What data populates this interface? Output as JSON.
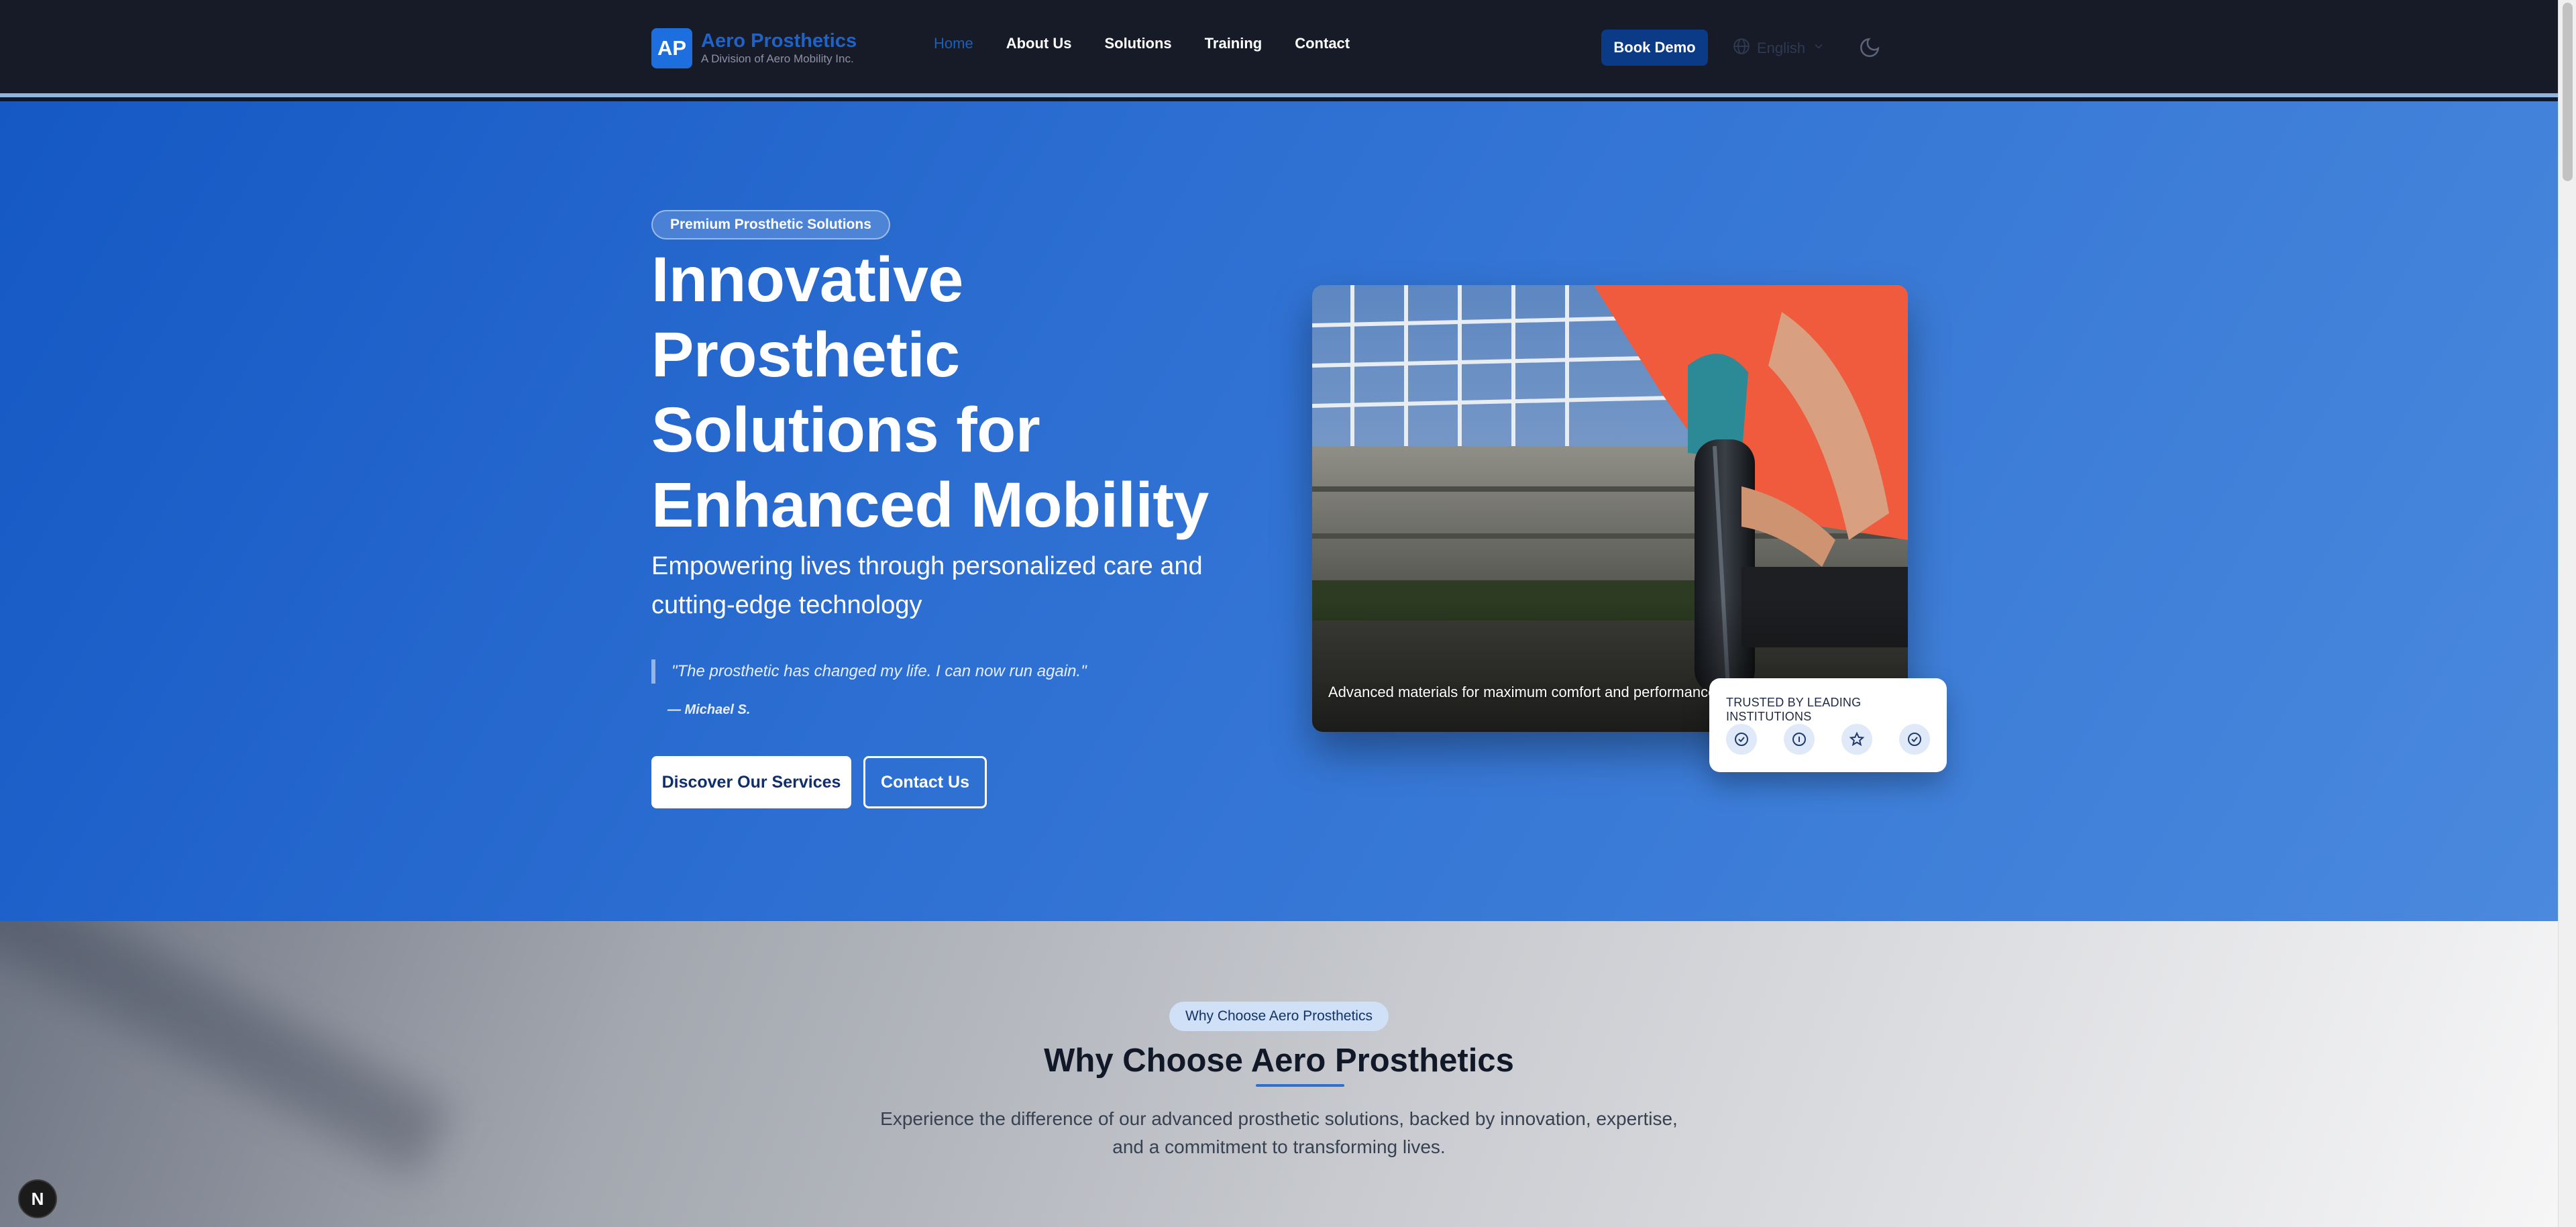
{
  "nav": {
    "logo_mark": "AP",
    "brand": "Aero Prosthetics",
    "subtitle": "A Division of Aero Mobility Inc.",
    "links": [
      {
        "label": "Home",
        "active": true
      },
      {
        "label": "About Us"
      },
      {
        "label": "Solutions"
      },
      {
        "label": "Training"
      },
      {
        "label": "Contact"
      }
    ],
    "book_demo": "Book Demo",
    "language": "English",
    "icons": [
      "globe-icon",
      "chevron-down-icon",
      "moon-icon"
    ]
  },
  "hero": {
    "badge": "Premium Prosthetic Solutions",
    "title": "Innovative Prosthetic Solutions for Enhanced Mobility",
    "subtitle": "Empowering lives through personalized care and cutting-edge technology",
    "quote": "\"The prosthetic has changed my life. I can now run again.\"",
    "quote_author": "— Michael S.",
    "primary_cta": "Discover Our Services",
    "secondary_cta": "Contact Us",
    "image_caption": "Advanced materials for maximum comfort and performance",
    "trusted_label": "TRUSTED BY LEADING INSTITUTIONS",
    "trusted_icons": [
      "check-circle-icon",
      "info-circle-icon",
      "star-icon",
      "check-circle-icon"
    ]
  },
  "why": {
    "badge": "Why Choose Aero Prosthetics",
    "title": "Why Choose Aero Prosthetics",
    "text_line1": "Experience the difference of our advanced prosthetic solutions, backed by innovation, expertise,",
    "text_line2": "and a commitment to transforming lives."
  },
  "colors": {
    "nav_bg": "#161b27",
    "brand_blue": "#1d6fe0",
    "cta_blue": "#0b3a87",
    "hero_gradient_start": "#1558c4",
    "hero_gradient_end": "#4a89dd"
  },
  "dev_badge": "N"
}
